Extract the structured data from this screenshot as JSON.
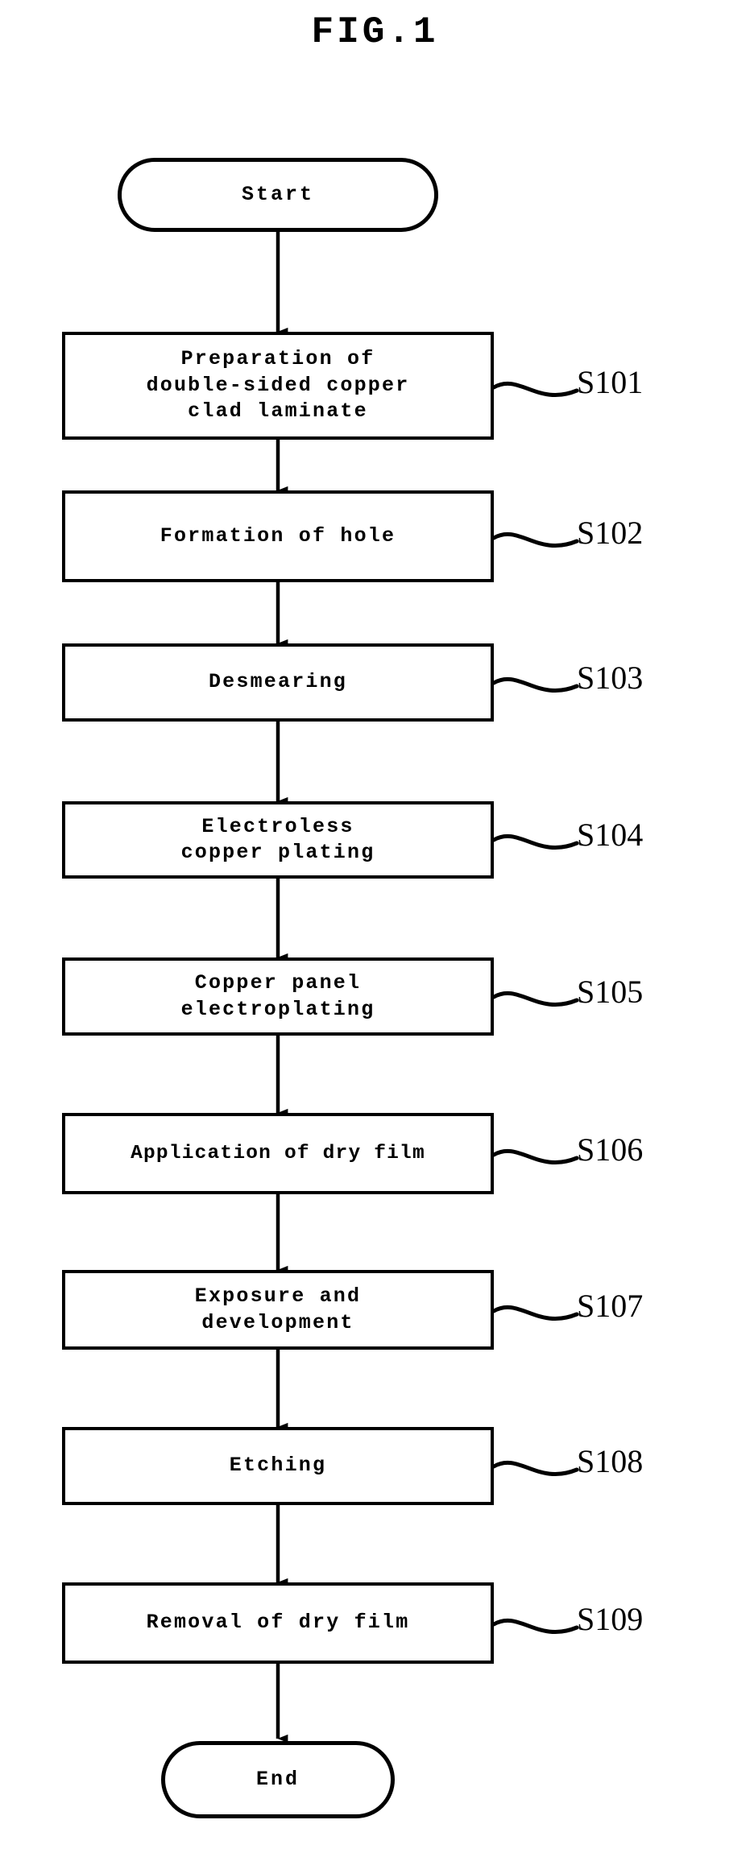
{
  "figure": {
    "title": "FIG.1",
    "type": "process-flowchart",
    "ink_color": "#000000",
    "background_color": "#ffffff"
  },
  "flowchart": {
    "start_node": {
      "label": "Start",
      "shape": "stadium"
    },
    "end_node": {
      "label": "End",
      "shape": "stadium"
    },
    "steps": [
      {
        "ref": "S101",
        "lines": [
          "Preparation of",
          "double-sided copper",
          "clad laminate"
        ],
        "text": "Preparation of double-sided copper clad laminate"
      },
      {
        "ref": "S102",
        "lines": [
          "Formation of hole"
        ],
        "text": "Formation of hole"
      },
      {
        "ref": "S103",
        "lines": [
          "Desmearing"
        ],
        "text": "Desmearing"
      },
      {
        "ref": "S104",
        "lines": [
          "Electroless",
          "copper plating"
        ],
        "text": "Electroless copper plating"
      },
      {
        "ref": "S105",
        "lines": [
          "Copper panel",
          "electroplating"
        ],
        "text": "Copper panel electroplating"
      },
      {
        "ref": "S106",
        "lines": [
          "Application of dry film"
        ],
        "text": "Application of dry film"
      },
      {
        "ref": "S107",
        "lines": [
          "Exposure and",
          "development"
        ],
        "text": "Exposure and development"
      },
      {
        "ref": "S108",
        "lines": [
          "Etching"
        ],
        "text": "Etching"
      },
      {
        "ref": "S109",
        "lines": [
          "Removal of dry film"
        ],
        "text": "Removal of dry film"
      }
    ]
  }
}
